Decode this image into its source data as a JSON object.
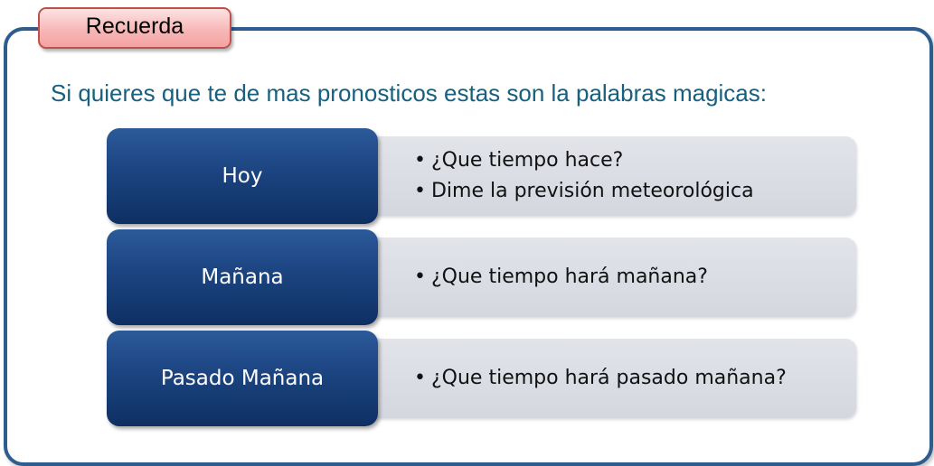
{
  "tag": {
    "label": "Recuerda"
  },
  "headline": "Si quieres que te de mas pronosticos estas son la palabras magicas:",
  "rows": [
    {
      "label": "Hoy",
      "bullets": [
        "¿Que tiempo hace?",
        "Dime la previsión meteorológica"
      ]
    },
    {
      "label": "Mañana",
      "bullets": [
        "¿Que tiempo hará mañana?"
      ]
    },
    {
      "label": "Pasado Mañana",
      "bullets": [
        "¿Que tiempo hará pasado mañana?"
      ]
    }
  ],
  "colors": {
    "frame_border": "#2e5c8e",
    "tag_fill": "#f8b7b7",
    "headline_text": "#17607f",
    "label_fill": "#1b4480",
    "panel_fill": "#d9dbe1"
  }
}
